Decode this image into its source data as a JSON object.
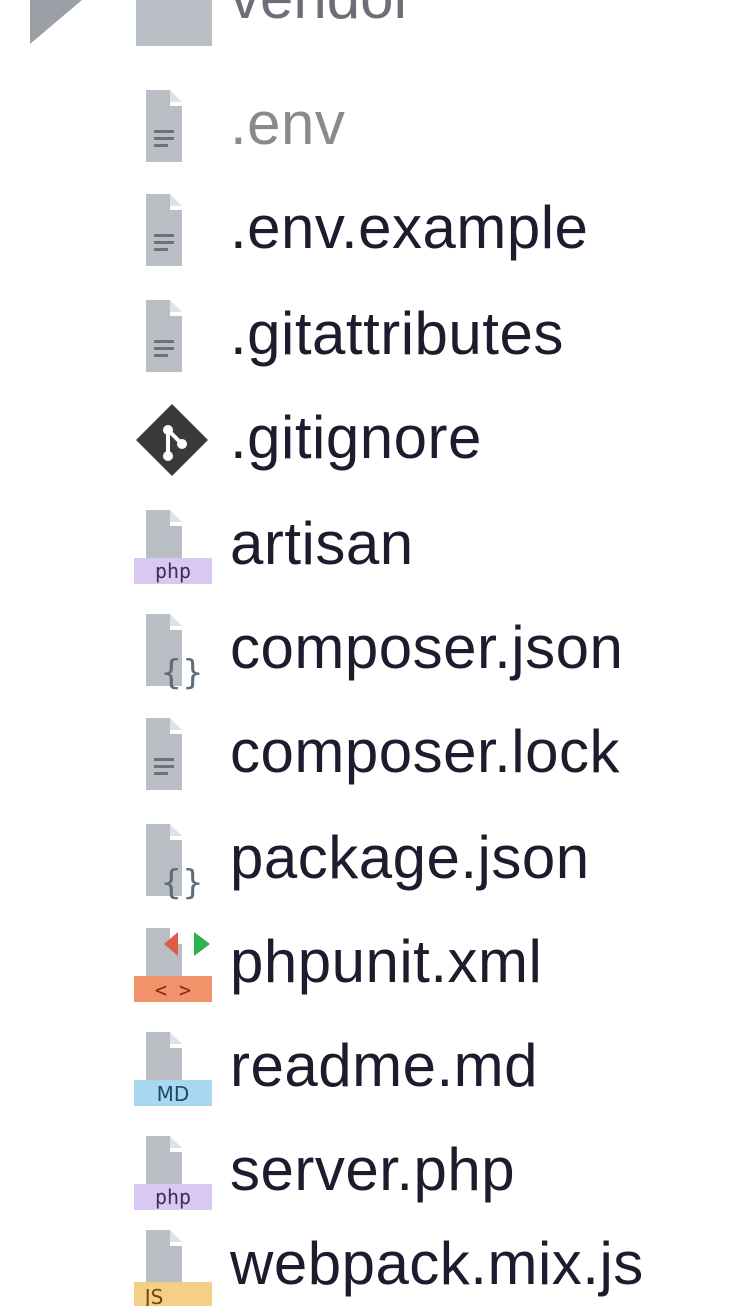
{
  "tree": {
    "folder": {
      "label": "vendor",
      "icon": "folder-icon"
    },
    "files": [
      {
        "label": ".env",
        "icon": "text-file-icon",
        "dim": true
      },
      {
        "label": ".env.example",
        "icon": "text-file-icon",
        "dim": false
      },
      {
        "label": ".gitattributes",
        "icon": "text-file-icon",
        "dim": false
      },
      {
        "label": ".gitignore",
        "icon": "git-icon",
        "dim": false
      },
      {
        "label": "artisan",
        "icon": "php-file-icon",
        "badge": "php",
        "dim": false
      },
      {
        "label": "composer.json",
        "icon": "json-file-icon",
        "dim": false
      },
      {
        "label": "composer.lock",
        "icon": "text-file-icon",
        "dim": false
      },
      {
        "label": "package.json",
        "icon": "json-file-icon",
        "dim": false
      },
      {
        "label": "phpunit.xml",
        "icon": "xml-file-icon",
        "badge": "< >",
        "dim": false
      },
      {
        "label": "readme.md",
        "icon": "markdown-file-icon",
        "badge": "MD",
        "dim": false
      },
      {
        "label": "server.php",
        "icon": "php-file-icon",
        "badge": "php",
        "dim": false
      },
      {
        "label": "webpack.mix.js",
        "icon": "js-file-icon",
        "badge": "JS",
        "dim": false
      }
    ]
  },
  "colors": {
    "text": "#1e1b2e",
    "dim_text": "#8a8a8a",
    "icon_gray": "#b9bec4",
    "php_badge": "#d9c8f2",
    "xml_badge": "#f2926a",
    "md_badge": "#a8d8ef",
    "js_badge": "#f5cf86",
    "git_icon": "#3a3a3a"
  }
}
